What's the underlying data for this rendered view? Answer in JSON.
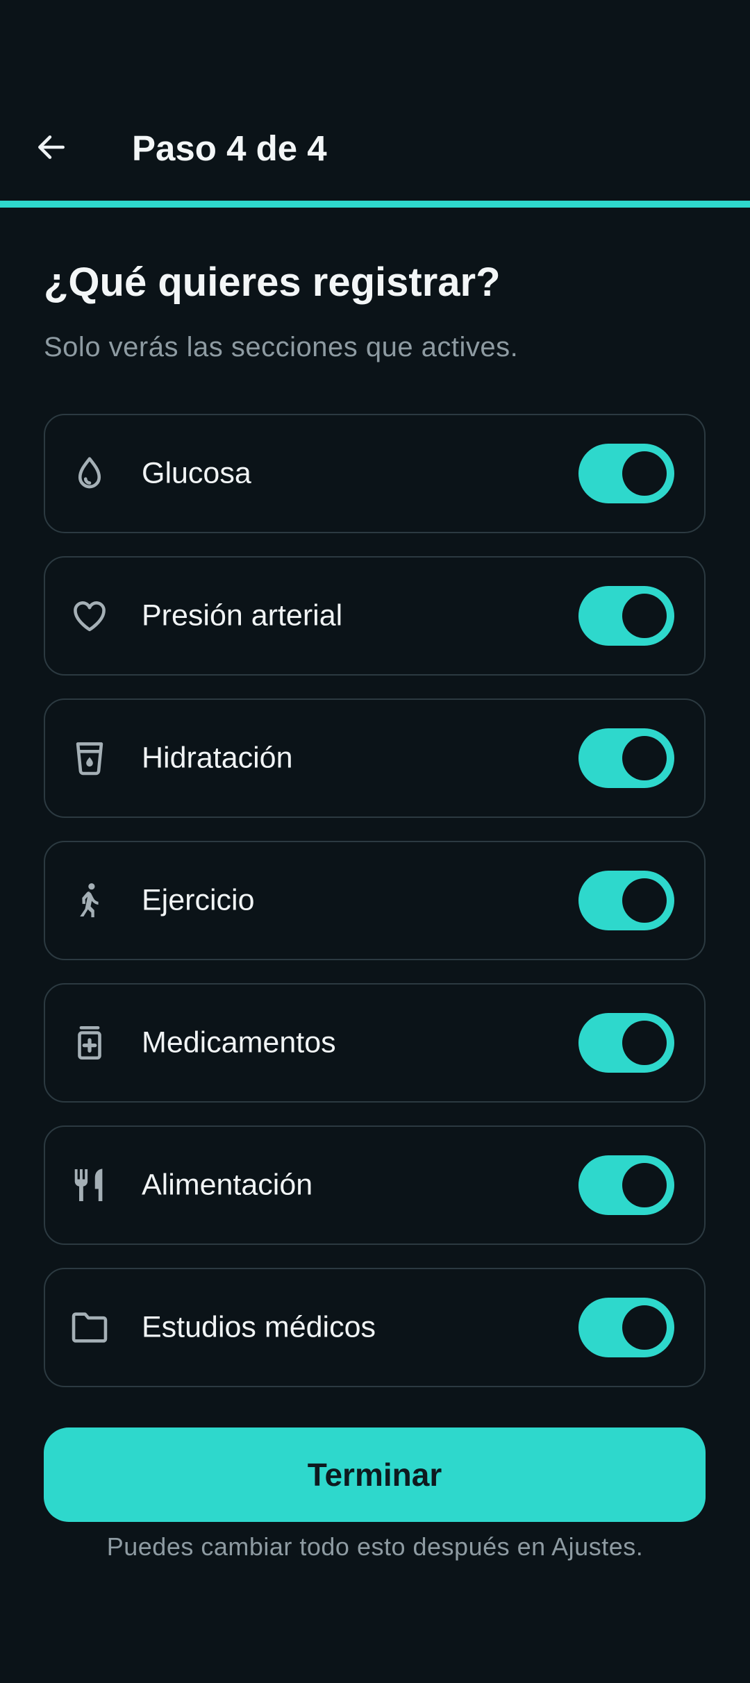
{
  "header": {
    "title": "Paso 4 de 4",
    "back_icon": "arrow-left-icon",
    "progress_fraction": 1.0
  },
  "intro": {
    "heading": "¿Qué quieres registrar?",
    "subheading": "Solo verás las secciones que actives."
  },
  "sections": [
    {
      "label": "Glucosa",
      "icon": "drop-icon",
      "enabled": true
    },
    {
      "label": "Presión arterial",
      "icon": "heart-icon",
      "enabled": true
    },
    {
      "label": "Hidratación",
      "icon": "water-glass-icon",
      "enabled": true
    },
    {
      "label": "Ejercicio",
      "icon": "walking-icon",
      "enabled": true
    },
    {
      "label": "Medicamentos",
      "icon": "medication-icon",
      "enabled": true
    },
    {
      "label": "Alimentación",
      "icon": "fork-knife-icon",
      "enabled": true
    },
    {
      "label": "Estudios médicos",
      "icon": "folder-icon",
      "enabled": true
    }
  ],
  "footer": {
    "button_label": "Terminar",
    "note": "Puedes cambiar todo esto después en Ajustes."
  },
  "colors": {
    "background": "#0b1318",
    "accent": "#2ed8cc",
    "card_border": "#2c3a41",
    "muted_text": "#8e9ba2"
  }
}
